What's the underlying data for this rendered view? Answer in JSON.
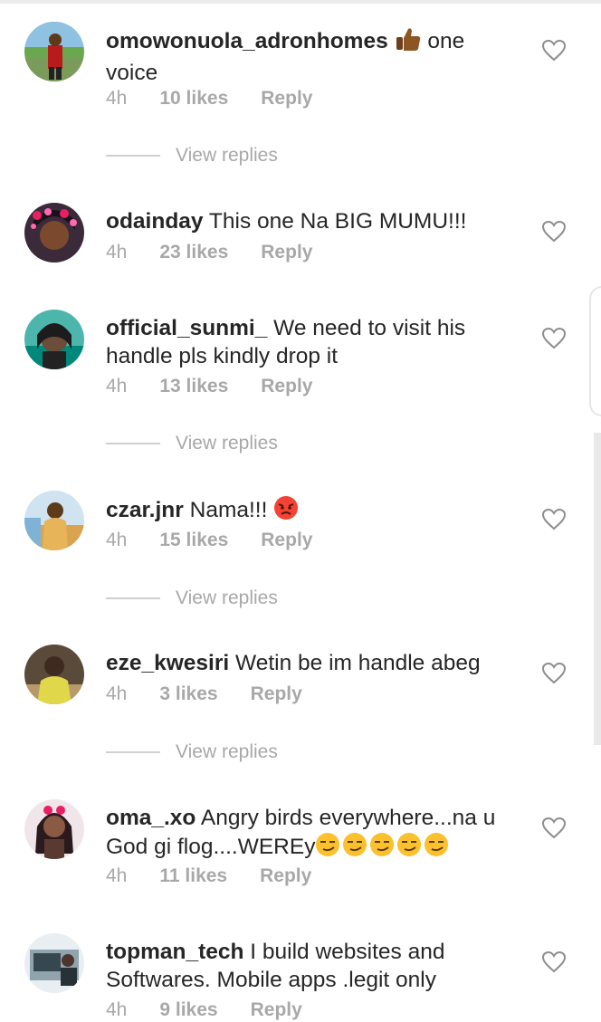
{
  "comments": [
    {
      "username": "omowonuola_adronhomes",
      "text_after_emoji": " one voice",
      "emoji": "thumbs-up-dark",
      "time": "4h",
      "likes": "10 likes",
      "reply": "Reply",
      "view_replies": "View replies"
    },
    {
      "username": "odainday",
      "text": " This one Na BIG MUMU!!!",
      "time": "4h",
      "likes": "23 likes",
      "reply": "Reply"
    },
    {
      "username": "official_sunmi_",
      "text": " We need to visit his handle pls kindly drop it",
      "time": "4h",
      "likes": "13 likes",
      "reply": "Reply",
      "view_replies": "View replies"
    },
    {
      "username": "czar.jnr",
      "text": " Nama!!! ",
      "emoji": "angry-face",
      "time": "4h",
      "likes": "15 likes",
      "reply": "Reply",
      "view_replies": "View replies"
    },
    {
      "username": "eze_kwesiri",
      "text": " Wetin be im handle abeg",
      "time": "4h",
      "likes": "3 likes",
      "reply": "Reply",
      "view_replies": "View replies"
    },
    {
      "username": "oma_.xo",
      "text": " Angry birds everywhere...na u God gi flog....WEREy",
      "emoji": "smirk-face x5",
      "time": "4h",
      "likes": "11 likes",
      "reply": "Reply"
    },
    {
      "username": "topman_tech",
      "text": " I build websites and Softwares. Mobile apps .legit only",
      "time": "4h",
      "likes": "9 likes",
      "reply": "Reply"
    }
  ],
  "colors": {
    "text": "#262626",
    "meta": "#a8a8a8",
    "line": "#d0d0d0",
    "heart": "#8e8e8e"
  }
}
